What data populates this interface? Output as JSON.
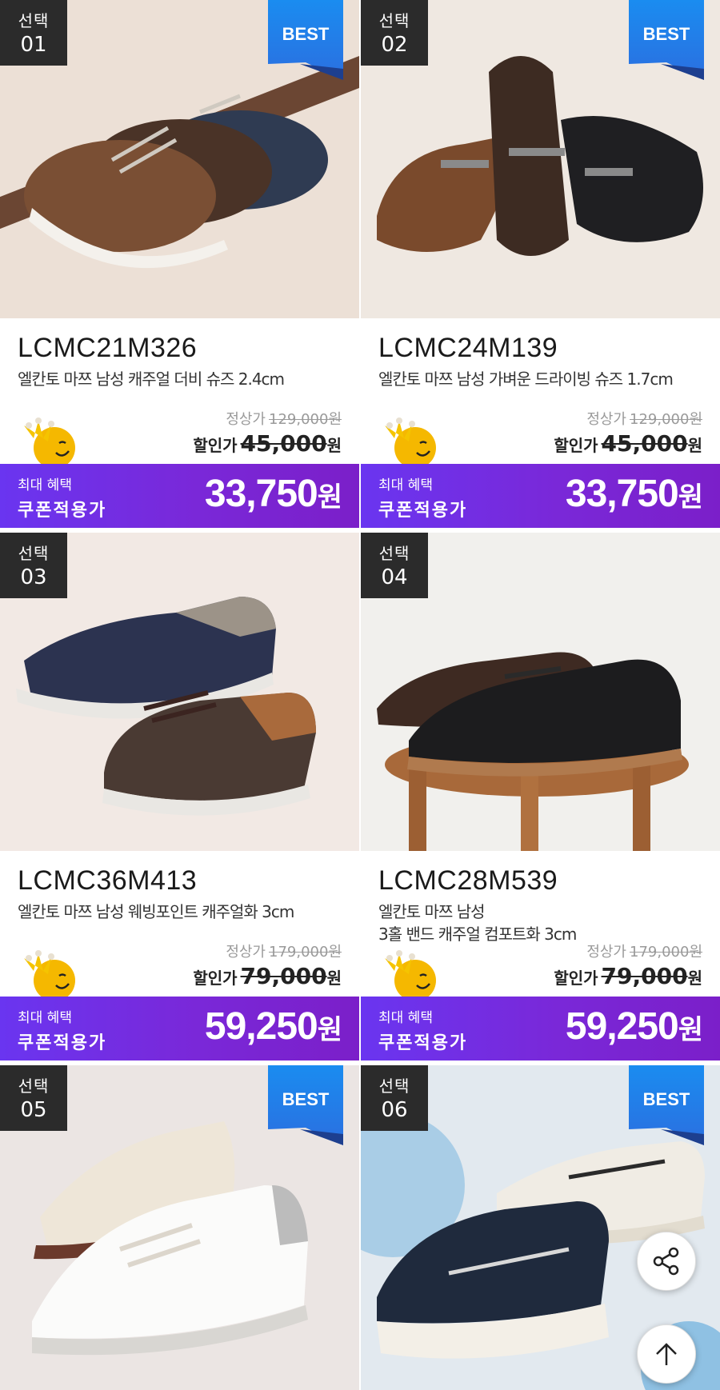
{
  "products": [
    {
      "select_label": "선택",
      "select_num": "01",
      "best": "BEST",
      "model": "LCMC21M326",
      "desc": "엘칸토 마쯔 남성 캐주얼 더비 슈즈 2.4cm",
      "orig_label": "정상가",
      "orig_price": "129,000",
      "orig_unit": "원",
      "disc_label": "할인가",
      "disc_price": "45,000",
      "disc_unit": "원",
      "coupon_l1": "최대 혜택",
      "coupon_l2": "쿠폰적용가",
      "coupon_price": "33,750",
      "coupon_unit": "원"
    },
    {
      "select_label": "선택",
      "select_num": "02",
      "best": "BEST",
      "model": "LCMC24M139",
      "desc": "엘칸토 마쯔 남성 가벼운 드라이빙 슈즈 1.7cm",
      "orig_label": "정상가",
      "orig_price": "129,000",
      "orig_unit": "원",
      "disc_label": "할인가",
      "disc_price": "45,000",
      "disc_unit": "원",
      "coupon_l1": "최대 혜택",
      "coupon_l2": "쿠폰적용가",
      "coupon_price": "33,750",
      "coupon_unit": "원"
    },
    {
      "select_label": "선택",
      "select_num": "03",
      "model": "LCMC36M413",
      "desc": "엘칸토 마쯔 남성 웨빙포인트 캐주얼화 3cm",
      "orig_label": "정상가",
      "orig_price": "179,000",
      "orig_unit": "원",
      "disc_label": "할인가",
      "disc_price": "79,000",
      "disc_unit": "원",
      "coupon_l1": "최대 혜택",
      "coupon_l2": "쿠폰적용가",
      "coupon_price": "59,250",
      "coupon_unit": "원"
    },
    {
      "select_label": "선택",
      "select_num": "04",
      "model": "LCMC28M539",
      "desc_line1": "엘칸토 마쯔 남성",
      "desc_line2": "3홀 밴드 캐주얼 컴포트화 3cm",
      "orig_label": "정상가",
      "orig_price": "179,000",
      "orig_unit": "원",
      "disc_label": "할인가",
      "disc_price": "79,000",
      "disc_unit": "원",
      "coupon_l1": "최대 혜택",
      "coupon_l2": "쿠폰적용가",
      "coupon_price": "59,250",
      "coupon_unit": "원"
    },
    {
      "select_label": "선택",
      "select_num": "05",
      "best": "BEST"
    },
    {
      "select_label": "선택",
      "select_num": "06",
      "best": "BEST"
    }
  ],
  "colors": {
    "coupon_start": "#6a35f0",
    "coupon_end": "#7b1fc9",
    "best_blue": "#1a8cf0",
    "select_badge": "#2b2b2b"
  },
  "icons": [
    "share-icon",
    "arrow-up-icon",
    "mascot-icon"
  ]
}
